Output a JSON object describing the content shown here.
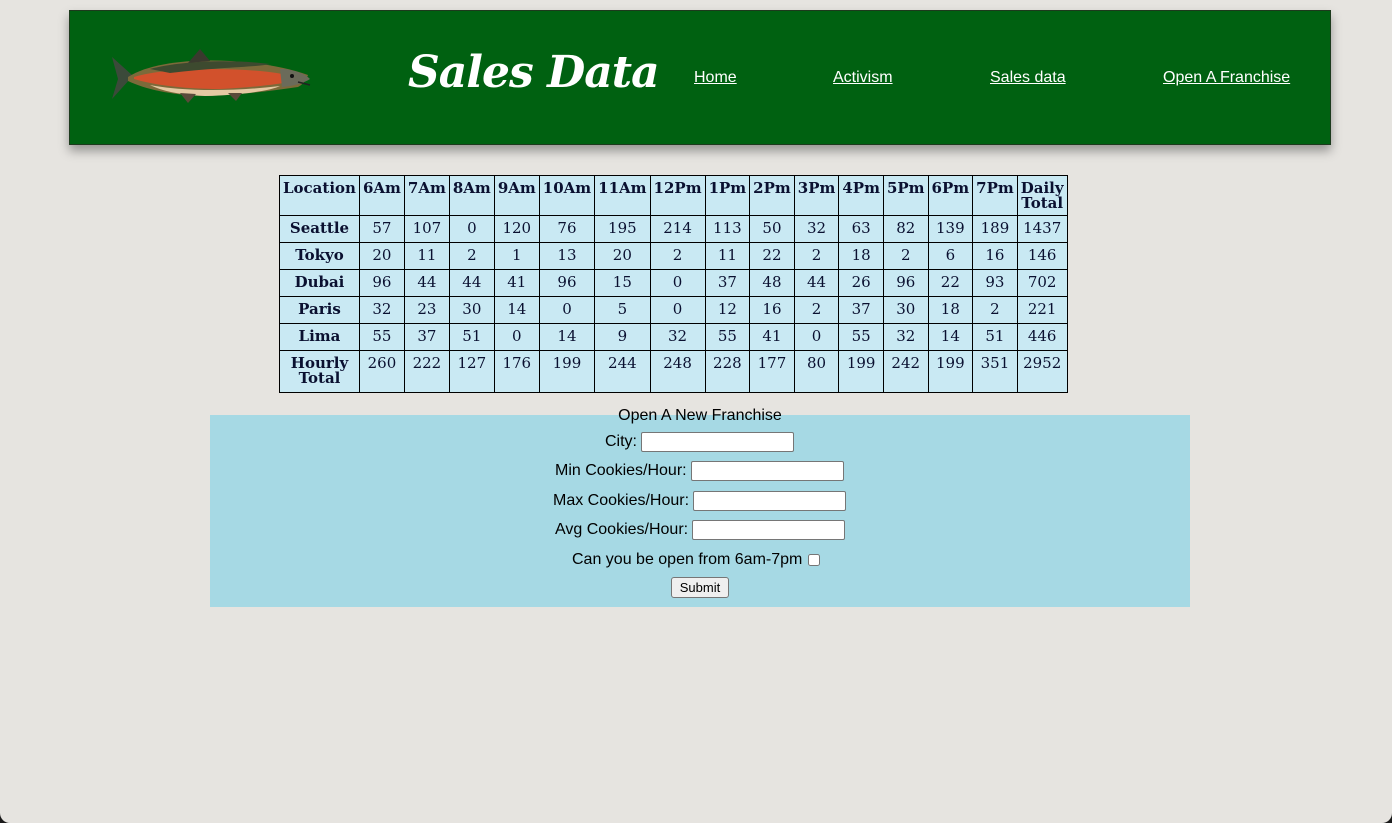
{
  "header": {
    "title": "Sales Data",
    "logo": "salmon-fish-logo",
    "nav": [
      "Home",
      "Activism",
      "Sales data",
      "Open A Franchise"
    ],
    "bg_color": "#006111"
  },
  "sales_table": {
    "columns": [
      "Location",
      "6Am",
      "7Am",
      "8Am",
      "9Am",
      "10Am",
      "11Am",
      "12Pm",
      "1Pm",
      "2Pm",
      "3Pm",
      "4Pm",
      "5Pm",
      "6Pm",
      "7Pm",
      "Daily Total"
    ],
    "rows": [
      {
        "location": "Seattle",
        "values": [
          "57",
          "107",
          "0",
          "120",
          "76",
          "195",
          "214",
          "113",
          "50",
          "32",
          "63",
          "82",
          "139",
          "189",
          "1437"
        ]
      },
      {
        "location": "Tokyo",
        "values": [
          "20",
          "11",
          "2",
          "1",
          "13",
          "20",
          "2",
          "11",
          "22",
          "2",
          "18",
          "2",
          "6",
          "16",
          "146"
        ]
      },
      {
        "location": "Dubai",
        "values": [
          "96",
          "44",
          "44",
          "41",
          "96",
          "15",
          "0",
          "37",
          "48",
          "44",
          "26",
          "96",
          "22",
          "93",
          "702"
        ]
      },
      {
        "location": "Paris",
        "values": [
          "32",
          "23",
          "30",
          "14",
          "0",
          "5",
          "0",
          "12",
          "16",
          "2",
          "37",
          "30",
          "18",
          "2",
          "221"
        ]
      },
      {
        "location": "Lima",
        "values": [
          "55",
          "37",
          "51",
          "0",
          "14",
          "9",
          "32",
          "55",
          "41",
          "0",
          "55",
          "32",
          "14",
          "51",
          "446"
        ]
      }
    ],
    "footer": {
      "label": "Hourly Total",
      "values": [
        "260",
        "222",
        "127",
        "176",
        "199",
        "244",
        "248",
        "228",
        "177",
        "80",
        "199",
        "242",
        "199",
        "351",
        "2952"
      ]
    },
    "bg_color": "#c9e9f3"
  },
  "form": {
    "title": "Open A New Franchise",
    "city_label": "City:",
    "city_value": "",
    "min_label": "Min Cookies/Hour:",
    "min_value": "",
    "max_label": "Max Cookies/Hour:",
    "max_value": "",
    "avg_label": "Avg Cookies/Hour:",
    "avg_value": "",
    "open_label": "Can you be open from 6am-7pm",
    "open_checked": false,
    "submit_label": "Submit",
    "bg_color": "#a6d9e4"
  }
}
